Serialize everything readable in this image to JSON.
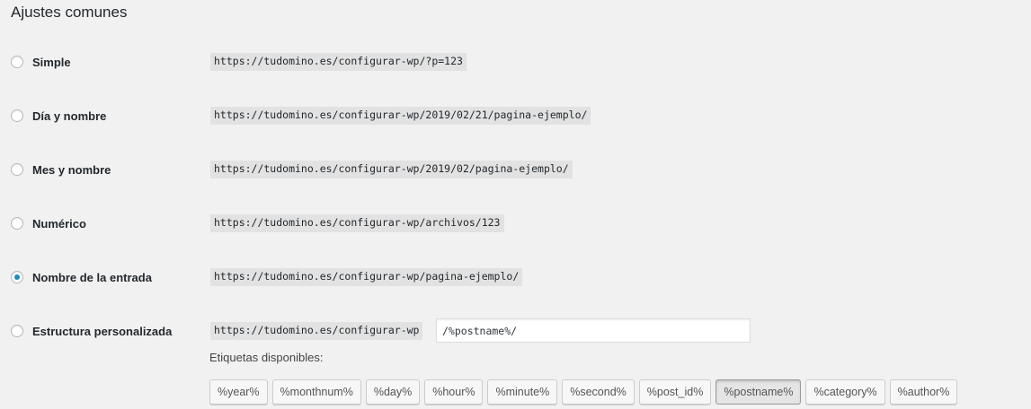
{
  "section": {
    "title": "Ajustes comunes"
  },
  "options": [
    {
      "label": "Simple",
      "url": "https://tudomino.es/configurar-wp/?p=123",
      "selected": false
    },
    {
      "label": "Día y nombre",
      "url": "https://tudomino.es/configurar-wp/2019/02/21/pagina-ejemplo/",
      "selected": false
    },
    {
      "label": "Mes y nombre",
      "url": "https://tudomino.es/configurar-wp/2019/02/pagina-ejemplo/",
      "selected": false
    },
    {
      "label": "Numérico",
      "url": "https://tudomino.es/configurar-wp/archivos/123",
      "selected": false
    },
    {
      "label": "Nombre de la entrada",
      "url": "https://tudomino.es/configurar-wp/pagina-ejemplo/",
      "selected": true
    },
    {
      "label": "Estructura personalizada",
      "url": "https://tudomino.es/configurar-wp",
      "selected": false
    }
  ],
  "custom": {
    "value": "/%postname%/"
  },
  "tags": {
    "label": "Etiquetas disponibles:",
    "items": [
      {
        "label": "%year%",
        "active": false
      },
      {
        "label": "%monthnum%",
        "active": false
      },
      {
        "label": "%day%",
        "active": false
      },
      {
        "label": "%hour%",
        "active": false
      },
      {
        "label": "%minute%",
        "active": false
      },
      {
        "label": "%second%",
        "active": false
      },
      {
        "label": "%post_id%",
        "active": false
      },
      {
        "label": "%postname%",
        "active": true
      },
      {
        "label": "%category%",
        "active": false
      },
      {
        "label": "%author%",
        "active": false
      }
    ]
  },
  "colors": {
    "radio_checked": "#1e8cbe",
    "background": "#f1f1f1",
    "code_background": "#e2e2e2"
  }
}
